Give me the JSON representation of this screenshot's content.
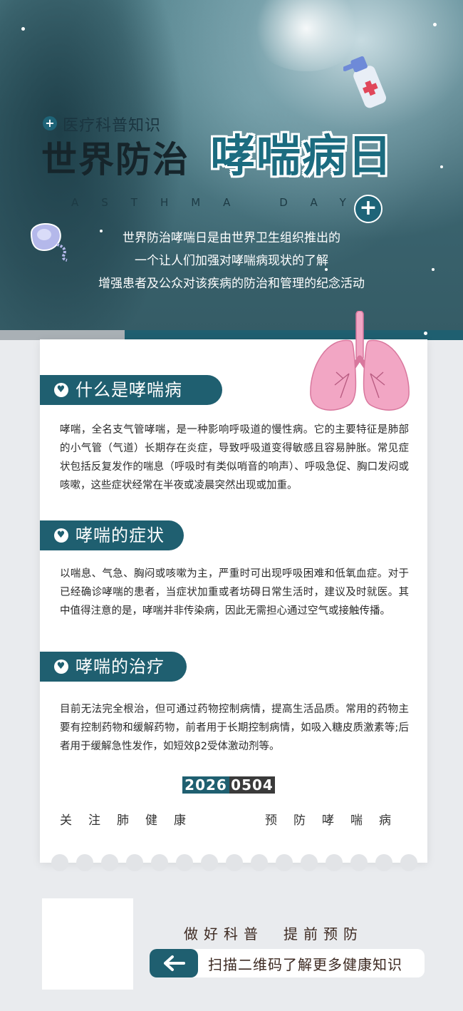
{
  "hero": {
    "tag": "医疗科普知识",
    "title_dark": "世界防治",
    "title_highlight": "哮喘病日",
    "subtitle_en": "ASTHMA DAY",
    "lines": [
      "世界防治哮喘日是由世界卫生组织推出的",
      "一个让人们加强对哮喘病现状的了解",
      "增强患者及公众对该疾病的防治和管理的纪念活动"
    ]
  },
  "sections": [
    {
      "heading": "什么是哮喘病",
      "body": "哮喘，全名支气管哮喘，是一种影响呼吸道的慢性病。它的主要特征是肺部的小气管（气道）长期存在炎症，导致呼吸道变得敏感且容易肿胀。常见症状包括反复发作的喘息（呼吸时有类似哨音的响声）、呼吸急促、胸口发闷或咳嗽，这些症状经常在半夜或凌晨突然出现或加重。"
    },
    {
      "heading": "哮喘的症状",
      "body": "以喘息、气急、胸闷或咳嗽为主，严重时可出现呼吸困难和低氧血症。对于已经确诊哮喘的患者，当症状加重或者坊碍日常生活时，建议及时就医。其中值得注意的是，哮喘并非传染病，因此无需担心通过空气或接触传播。"
    },
    {
      "heading": "哮喘的治疗",
      "body": "目前无法完全根治，但可通过药物控制病情，提高生活品质。常用的药物主要有控制药物和缓解药物，前者用于长期控制病情，如吸入糖皮质激素等;后者用于缓解急性发作，如短效β2受体激动剂等。"
    }
  ],
  "date": {
    "year": "2026",
    "day": "0504"
  },
  "slogans": {
    "left": "关注肺健康",
    "right": "预防哮喘病"
  },
  "footer": {
    "top": "做好科普　提前预防",
    "cta": "扫描二维码了解更多健康知识"
  },
  "colors": {
    "accent": "#1f5f70",
    "highlight": "#1c6c80",
    "page_bg": "#e9ebee",
    "lung_pink": "#f2a6c4"
  }
}
